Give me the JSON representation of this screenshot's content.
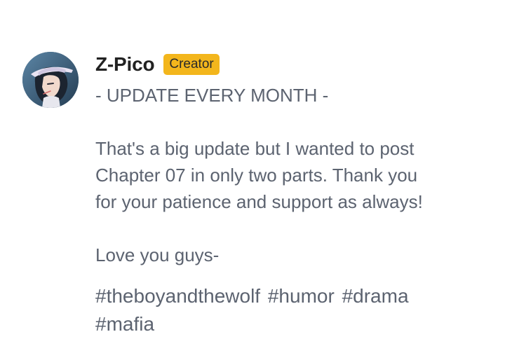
{
  "author": {
    "avatar_icon": "user-avatar-image",
    "name": "Z-Pico",
    "badge": "Creator",
    "badge_color": "#f3b61c"
  },
  "post": {
    "line1": "- UPDATE EVERY MONTH -",
    "paragraph": "That's a big update but I wanted to post\nChapter 07 in only two parts. Thank you\nfor your patience and support as always!",
    "closing": "Love you guys-"
  },
  "tags": [
    "#theboyandthewolf",
    "#humor",
    "#drama",
    "#mafia"
  ]
}
